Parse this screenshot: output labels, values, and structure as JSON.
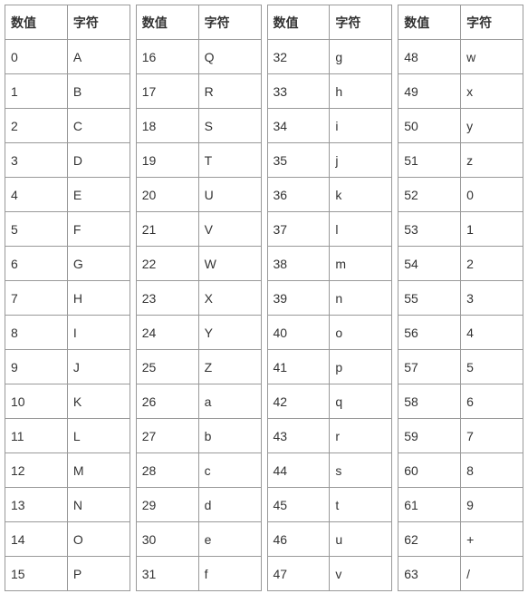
{
  "headers": {
    "value": "数值",
    "char": "字符"
  },
  "columns": [
    {
      "rows": [
        {
          "v": "0",
          "c": "A"
        },
        {
          "v": "1",
          "c": "B"
        },
        {
          "v": "2",
          "c": "C"
        },
        {
          "v": "3",
          "c": "D"
        },
        {
          "v": "4",
          "c": "E"
        },
        {
          "v": "5",
          "c": "F"
        },
        {
          "v": "6",
          "c": "G"
        },
        {
          "v": "7",
          "c": "H"
        },
        {
          "v": "8",
          "c": "I"
        },
        {
          "v": "9",
          "c": "J"
        },
        {
          "v": "10",
          "c": "K"
        },
        {
          "v": "11",
          "c": "L"
        },
        {
          "v": "12",
          "c": "M"
        },
        {
          "v": "13",
          "c": "N"
        },
        {
          "v": "14",
          "c": "O"
        },
        {
          "v": "15",
          "c": "P"
        }
      ]
    },
    {
      "rows": [
        {
          "v": "16",
          "c": "Q"
        },
        {
          "v": "17",
          "c": "R"
        },
        {
          "v": "18",
          "c": "S"
        },
        {
          "v": "19",
          "c": "T"
        },
        {
          "v": "20",
          "c": "U"
        },
        {
          "v": "21",
          "c": "V"
        },
        {
          "v": "22",
          "c": "W"
        },
        {
          "v": "23",
          "c": "X"
        },
        {
          "v": "24",
          "c": "Y"
        },
        {
          "v": "25",
          "c": "Z"
        },
        {
          "v": "26",
          "c": "a"
        },
        {
          "v": "27",
          "c": "b"
        },
        {
          "v": "28",
          "c": "c"
        },
        {
          "v": "29",
          "c": "d"
        },
        {
          "v": "30",
          "c": "e"
        },
        {
          "v": "31",
          "c": "f"
        }
      ]
    },
    {
      "rows": [
        {
          "v": "32",
          "c": "g"
        },
        {
          "v": "33",
          "c": "h"
        },
        {
          "v": "34",
          "c": "i"
        },
        {
          "v": "35",
          "c": "j"
        },
        {
          "v": "36",
          "c": "k"
        },
        {
          "v": "37",
          "c": "l"
        },
        {
          "v": "38",
          "c": "m"
        },
        {
          "v": "39",
          "c": "n"
        },
        {
          "v": "40",
          "c": "o"
        },
        {
          "v": "41",
          "c": "p"
        },
        {
          "v": "42",
          "c": "q"
        },
        {
          "v": "43",
          "c": "r"
        },
        {
          "v": "44",
          "c": "s"
        },
        {
          "v": "45",
          "c": "t"
        },
        {
          "v": "46",
          "c": "u"
        },
        {
          "v": "47",
          "c": "v"
        }
      ]
    },
    {
      "rows": [
        {
          "v": "48",
          "c": "w"
        },
        {
          "v": "49",
          "c": "x"
        },
        {
          "v": "50",
          "c": "y"
        },
        {
          "v": "51",
          "c": "z"
        },
        {
          "v": "52",
          "c": "0"
        },
        {
          "v": "53",
          "c": "1"
        },
        {
          "v": "54",
          "c": "2"
        },
        {
          "v": "55",
          "c": "3"
        },
        {
          "v": "56",
          "c": "4"
        },
        {
          "v": "57",
          "c": "5"
        },
        {
          "v": "58",
          "c": "6"
        },
        {
          "v": "59",
          "c": "7"
        },
        {
          "v": "60",
          "c": "8"
        },
        {
          "v": "61",
          "c": "9"
        },
        {
          "v": "62",
          "c": "+"
        },
        {
          "v": "63",
          "c": "/"
        }
      ]
    }
  ],
  "chart_data": {
    "type": "table",
    "title": "",
    "columns": [
      "数值",
      "字符",
      "数值",
      "字符",
      "数值",
      "字符",
      "数值",
      "字符"
    ],
    "data": [
      [
        0,
        "A",
        16,
        "Q",
        32,
        "g",
        48,
        "w"
      ],
      [
        1,
        "B",
        17,
        "R",
        33,
        "h",
        49,
        "x"
      ],
      [
        2,
        "C",
        18,
        "S",
        34,
        "i",
        50,
        "y"
      ],
      [
        3,
        "D",
        19,
        "T",
        35,
        "j",
        51,
        "z"
      ],
      [
        4,
        "E",
        20,
        "U",
        36,
        "k",
        52,
        "0"
      ],
      [
        5,
        "F",
        21,
        "V",
        37,
        "l",
        53,
        "1"
      ],
      [
        6,
        "G",
        22,
        "W",
        38,
        "m",
        54,
        "2"
      ],
      [
        7,
        "H",
        23,
        "X",
        39,
        "n",
        55,
        "3"
      ],
      [
        8,
        "I",
        24,
        "Y",
        40,
        "o",
        56,
        "4"
      ],
      [
        9,
        "J",
        25,
        "Z",
        41,
        "p",
        57,
        "5"
      ],
      [
        10,
        "K",
        26,
        "a",
        42,
        "q",
        58,
        "6"
      ],
      [
        11,
        "L",
        27,
        "b",
        43,
        "r",
        59,
        "7"
      ],
      [
        12,
        "M",
        28,
        "c",
        44,
        "s",
        60,
        "8"
      ],
      [
        13,
        "N",
        29,
        "d",
        45,
        "t",
        61,
        "9"
      ],
      [
        14,
        "O",
        30,
        "e",
        46,
        "u",
        62,
        "+"
      ],
      [
        15,
        "P",
        31,
        "f",
        47,
        "v",
        63,
        "/"
      ]
    ]
  }
}
